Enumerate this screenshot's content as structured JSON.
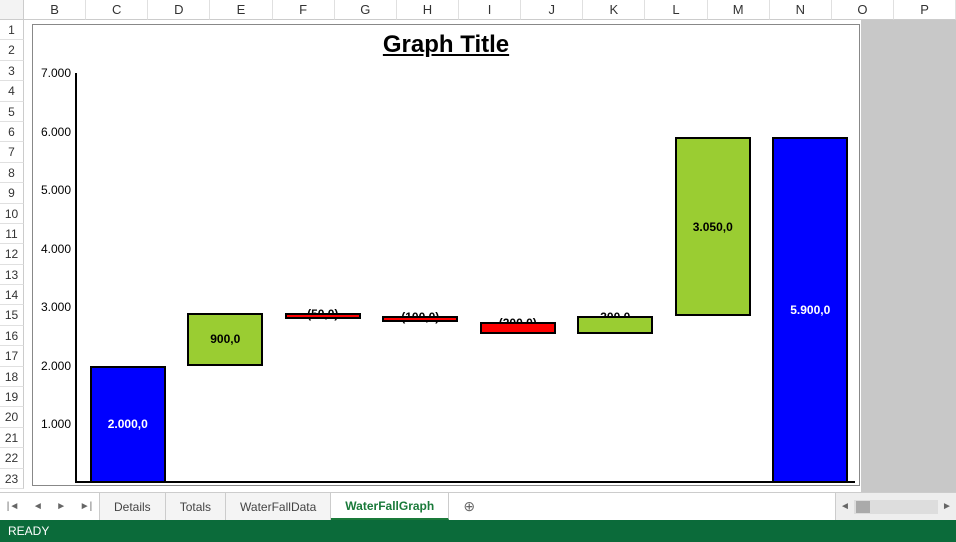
{
  "columns": [
    "B",
    "C",
    "D",
    "E",
    "F",
    "G",
    "H",
    "I",
    "J",
    "K",
    "L",
    "M",
    "N",
    "O",
    "P"
  ],
  "rows": [
    "1",
    "2",
    "3",
    "4",
    "5",
    "6",
    "7",
    "8",
    "9",
    "10",
    "11",
    "12",
    "13",
    "14",
    "15",
    "16",
    "17",
    "18",
    "19",
    "20",
    "21",
    "22",
    "23"
  ],
  "chart_data": {
    "type": "bar",
    "subtype": "waterfall",
    "title": "Graph Title",
    "ylim": [
      0,
      7000
    ],
    "y_ticks": [
      "1.000",
      "2.000",
      "3.000",
      "4.000",
      "5.000",
      "6.000",
      "7.000"
    ],
    "bars": [
      {
        "kind": "total",
        "label": "2.000,0",
        "start": 0,
        "end": 2000,
        "value": 2000
      },
      {
        "kind": "pos",
        "label": "900,0",
        "start": 2000,
        "end": 2900,
        "value": 900
      },
      {
        "kind": "neg",
        "label": "(50,0)",
        "start": 2850,
        "end": 2900,
        "value": -50
      },
      {
        "kind": "neg",
        "label": "(100,0)",
        "start": 2750,
        "end": 2850,
        "value": -100
      },
      {
        "kind": "neg",
        "label": "(200,0)",
        "start": 2550,
        "end": 2750,
        "value": -200
      },
      {
        "kind": "pos",
        "label": "300,0",
        "start": 2550,
        "end": 2850,
        "value": 300
      },
      {
        "kind": "pos",
        "label": "3.050,0",
        "start": 2850,
        "end": 5900,
        "value": 3050
      },
      {
        "kind": "total",
        "label": "5.900,0",
        "start": 0,
        "end": 5900,
        "value": 5900
      }
    ]
  },
  "tabs": {
    "items": [
      "Details",
      "Totals",
      "WaterFallData",
      "WaterFallGraph"
    ],
    "active": "WaterFallGraph",
    "add_icon": "⊕"
  },
  "status": {
    "text": "READY"
  }
}
